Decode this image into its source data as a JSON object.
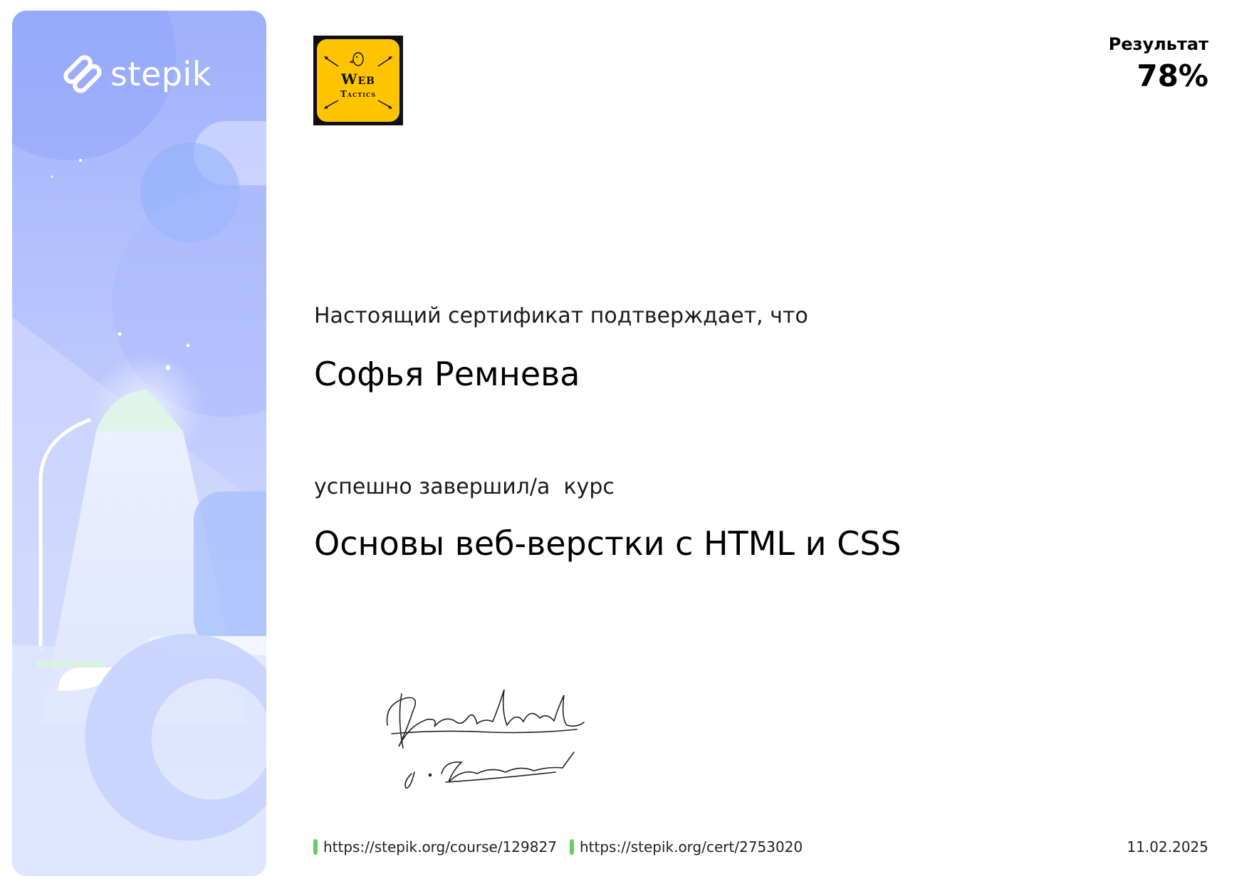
{
  "brand": {
    "name": "stepik",
    "icon": "stepik-logo-icon"
  },
  "partner": {
    "line_1": "Web",
    "line_2": "Tactics",
    "background_color": "#ffc400"
  },
  "result": {
    "label": "Результат",
    "value": "78%"
  },
  "certificate": {
    "intro": "Настоящий сертификат подтверждает, что",
    "recipient": "Софья Ремнева",
    "completed_text": "успешно завершил/а  курс",
    "course_title": "Основы веб-верстки с HTML и CSS"
  },
  "footer": {
    "course_url": "https://stepik.org/course/129827",
    "cert_url": "https://stepik.org/cert/2753020",
    "date": "11.02.2025",
    "marker_color": "#66cc66"
  }
}
